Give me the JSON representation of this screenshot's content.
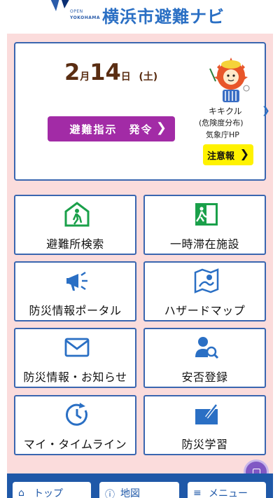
{
  "header": {
    "logo_open": "OPEN",
    "logo_city": "YOKOHAMA",
    "title": "横浜市避難ナビ"
  },
  "top_card": {
    "date_month": "2",
    "date_month_unit": "月",
    "date_day": "14",
    "date_day_unit": "日",
    "weekday": "(土)",
    "evac_button_label": "避難指示　発令",
    "mascot_name": "キキクル",
    "mascot_sub": "(危険度分布)",
    "jma_link": "気象庁HP",
    "caution_label": "注意報"
  },
  "tiles": [
    {
      "id": "shelter-search",
      "label": "避難所検索",
      "icon": "shelter-icon"
    },
    {
      "id": "temp-stay",
      "label": "一時滞在施設",
      "icon": "exit-door-icon"
    },
    {
      "id": "disaster-portal",
      "label": "防災情報ポータル",
      "icon": "megaphone-icon"
    },
    {
      "id": "hazard-map",
      "label": "ハザードマップ",
      "icon": "map-icon"
    },
    {
      "id": "disaster-news",
      "label": "防災情報・お知らせ",
      "icon": "mail-icon"
    },
    {
      "id": "safety-register",
      "label": "安否登録",
      "icon": "person-search-icon"
    },
    {
      "id": "my-timeline",
      "label": "マイ・タイムライン",
      "icon": "clock-icon"
    },
    {
      "id": "disaster-learning",
      "label": "防災学習",
      "icon": "study-icon"
    }
  ],
  "bottom_nav": {
    "items": [
      {
        "label": "トップ",
        "icon": "home-icon"
      },
      {
        "label": "地図",
        "icon": "info-icon"
      },
      {
        "label": "メニュー",
        "icon": "menu-icon"
      }
    ]
  },
  "colors": {
    "accent_blue": "#2a6fc4",
    "border_blue": "#3a66b0",
    "evac_purple": "#a22ba6",
    "caution_yellow": "#fff200",
    "bg_pink": "#fbdcdc",
    "icon_green": "#1aa04a",
    "nav_blue": "#1f58a8"
  }
}
